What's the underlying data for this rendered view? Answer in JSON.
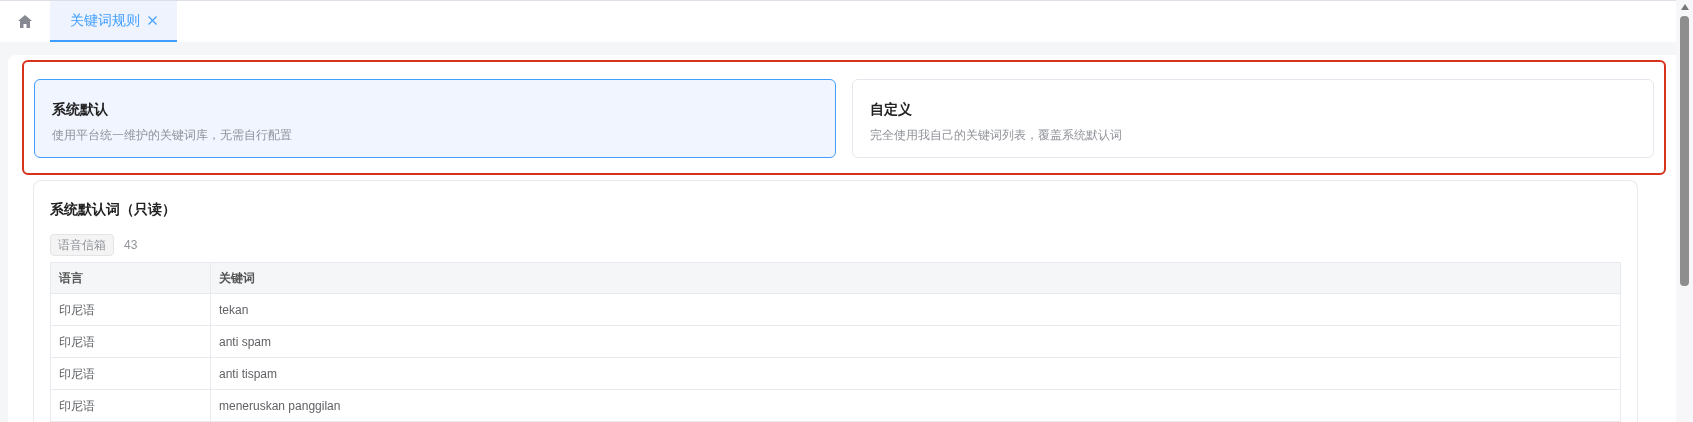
{
  "tabs": [
    {
      "label": "关键词规则",
      "selected": true,
      "closable": true
    }
  ],
  "modes": [
    {
      "title": "系统默认",
      "description": "使用平台统一维护的关键词库，无需自行配置",
      "selected": true
    },
    {
      "title": "自定义",
      "description": "完全使用我自己的关键词列表，覆盖系统默认词",
      "selected": false
    }
  ],
  "section": {
    "title": "系统默认词（只读）",
    "tag": "语音信箱",
    "count": "43"
  },
  "table": {
    "columns": [
      "语言",
      "关键词"
    ],
    "rows": [
      [
        "印尼语",
        "tekan"
      ],
      [
        "印尼语",
        "anti spam"
      ],
      [
        "印尼语",
        "anti tispam"
      ],
      [
        "印尼语",
        "meneruskan panggilan"
      ]
    ]
  }
}
